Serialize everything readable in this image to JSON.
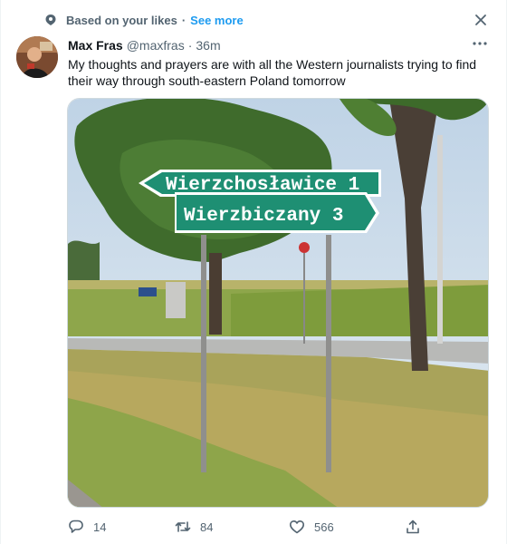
{
  "context": {
    "label": "Based on your likes",
    "separator": "·",
    "link": "See more"
  },
  "tweet": {
    "author_name": "Max Fras",
    "handle": "@maxfras",
    "separator": "·",
    "time": "36m",
    "text": "My thoughts and prayers are with all the Western journalists trying to find their way through south-eastern Poland tomorrow",
    "signs": {
      "top": "Wierzchosławice 1",
      "bottom": "Wierzbiczany 3"
    }
  },
  "actions": {
    "replies": "14",
    "retweets": "84",
    "likes": "566"
  },
  "icons": {
    "context": "sparkle-pin-icon",
    "close": "close-icon",
    "more": "more-icon",
    "reply": "reply-icon",
    "retweet": "retweet-icon",
    "like": "heart-icon",
    "share": "share-icon"
  },
  "colors": {
    "accent": "#1d9bf0",
    "secondary_text": "#536471",
    "sign_green": "#1e8f73"
  }
}
